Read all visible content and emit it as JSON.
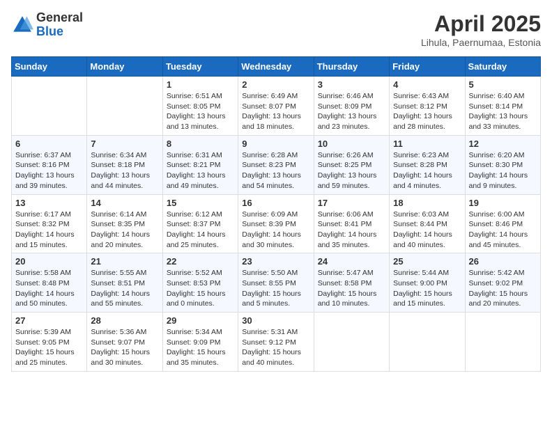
{
  "logo": {
    "general": "General",
    "blue": "Blue"
  },
  "title": "April 2025",
  "location": "Lihula, Paernumaa, Estonia",
  "days_of_week": [
    "Sunday",
    "Monday",
    "Tuesday",
    "Wednesday",
    "Thursday",
    "Friday",
    "Saturday"
  ],
  "weeks": [
    [
      null,
      null,
      {
        "day": "1",
        "sunrise": "6:51 AM",
        "sunset": "8:05 PM",
        "daylight": "13 hours and 13 minutes."
      },
      {
        "day": "2",
        "sunrise": "6:49 AM",
        "sunset": "8:07 PM",
        "daylight": "13 hours and 18 minutes."
      },
      {
        "day": "3",
        "sunrise": "6:46 AM",
        "sunset": "8:09 PM",
        "daylight": "13 hours and 23 minutes."
      },
      {
        "day": "4",
        "sunrise": "6:43 AM",
        "sunset": "8:12 PM",
        "daylight": "13 hours and 28 minutes."
      },
      {
        "day": "5",
        "sunrise": "6:40 AM",
        "sunset": "8:14 PM",
        "daylight": "13 hours and 33 minutes."
      }
    ],
    [
      {
        "day": "6",
        "sunrise": "6:37 AM",
        "sunset": "8:16 PM",
        "daylight": "13 hours and 39 minutes."
      },
      {
        "day": "7",
        "sunrise": "6:34 AM",
        "sunset": "8:18 PM",
        "daylight": "13 hours and 44 minutes."
      },
      {
        "day": "8",
        "sunrise": "6:31 AM",
        "sunset": "8:21 PM",
        "daylight": "13 hours and 49 minutes."
      },
      {
        "day": "9",
        "sunrise": "6:28 AM",
        "sunset": "8:23 PM",
        "daylight": "13 hours and 54 minutes."
      },
      {
        "day": "10",
        "sunrise": "6:26 AM",
        "sunset": "8:25 PM",
        "daylight": "13 hours and 59 minutes."
      },
      {
        "day": "11",
        "sunrise": "6:23 AM",
        "sunset": "8:28 PM",
        "daylight": "14 hours and 4 minutes."
      },
      {
        "day": "12",
        "sunrise": "6:20 AM",
        "sunset": "8:30 PM",
        "daylight": "14 hours and 9 minutes."
      }
    ],
    [
      {
        "day": "13",
        "sunrise": "6:17 AM",
        "sunset": "8:32 PM",
        "daylight": "14 hours and 15 minutes."
      },
      {
        "day": "14",
        "sunrise": "6:14 AM",
        "sunset": "8:35 PM",
        "daylight": "14 hours and 20 minutes."
      },
      {
        "day": "15",
        "sunrise": "6:12 AM",
        "sunset": "8:37 PM",
        "daylight": "14 hours and 25 minutes."
      },
      {
        "day": "16",
        "sunrise": "6:09 AM",
        "sunset": "8:39 PM",
        "daylight": "14 hours and 30 minutes."
      },
      {
        "day": "17",
        "sunrise": "6:06 AM",
        "sunset": "8:41 PM",
        "daylight": "14 hours and 35 minutes."
      },
      {
        "day": "18",
        "sunrise": "6:03 AM",
        "sunset": "8:44 PM",
        "daylight": "14 hours and 40 minutes."
      },
      {
        "day": "19",
        "sunrise": "6:00 AM",
        "sunset": "8:46 PM",
        "daylight": "14 hours and 45 minutes."
      }
    ],
    [
      {
        "day": "20",
        "sunrise": "5:58 AM",
        "sunset": "8:48 PM",
        "daylight": "14 hours and 50 minutes."
      },
      {
        "day": "21",
        "sunrise": "5:55 AM",
        "sunset": "8:51 PM",
        "daylight": "14 hours and 55 minutes."
      },
      {
        "day": "22",
        "sunrise": "5:52 AM",
        "sunset": "8:53 PM",
        "daylight": "15 hours and 0 minutes."
      },
      {
        "day": "23",
        "sunrise": "5:50 AM",
        "sunset": "8:55 PM",
        "daylight": "15 hours and 5 minutes."
      },
      {
        "day": "24",
        "sunrise": "5:47 AM",
        "sunset": "8:58 PM",
        "daylight": "15 hours and 10 minutes."
      },
      {
        "day": "25",
        "sunrise": "5:44 AM",
        "sunset": "9:00 PM",
        "daylight": "15 hours and 15 minutes."
      },
      {
        "day": "26",
        "sunrise": "5:42 AM",
        "sunset": "9:02 PM",
        "daylight": "15 hours and 20 minutes."
      }
    ],
    [
      {
        "day": "27",
        "sunrise": "5:39 AM",
        "sunset": "9:05 PM",
        "daylight": "15 hours and 25 minutes."
      },
      {
        "day": "28",
        "sunrise": "5:36 AM",
        "sunset": "9:07 PM",
        "daylight": "15 hours and 30 minutes."
      },
      {
        "day": "29",
        "sunrise": "5:34 AM",
        "sunset": "9:09 PM",
        "daylight": "15 hours and 35 minutes."
      },
      {
        "day": "30",
        "sunrise": "5:31 AM",
        "sunset": "9:12 PM",
        "daylight": "15 hours and 40 minutes."
      },
      null,
      null,
      null
    ]
  ]
}
